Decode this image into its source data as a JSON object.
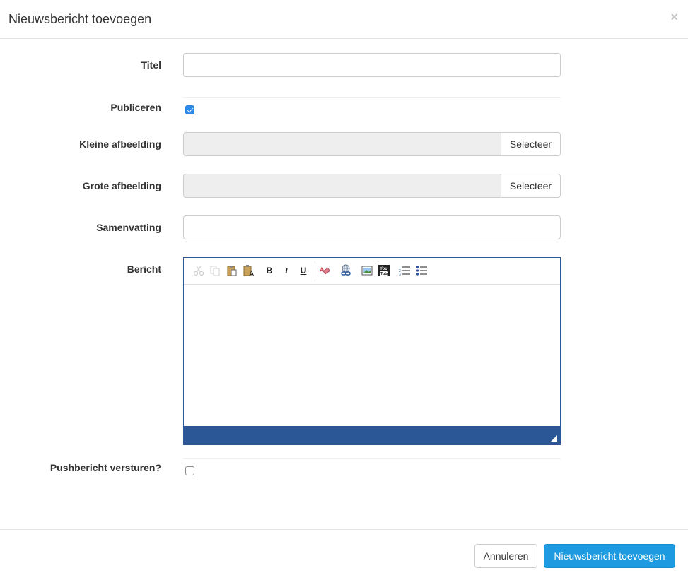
{
  "modal": {
    "title": "Nieuwsbericht toevoegen",
    "close_symbol": "×"
  },
  "form": {
    "title_label": "Titel",
    "title_value": "",
    "publish_label": "Publiceren",
    "publish_checked": true,
    "small_image_label": "Kleine afbeelding",
    "small_image_button": "Selecteer",
    "large_image_label": "Grote afbeelding",
    "large_image_button": "Selecteer",
    "summary_label": "Samenvatting",
    "summary_value": "",
    "message_label": "Bericht",
    "push_label": "Pushbericht versturen?",
    "push_checked": false
  },
  "editor": {
    "toolbar": [
      {
        "icon": "cut-icon",
        "enabled": false
      },
      {
        "icon": "copy-icon",
        "enabled": false
      },
      {
        "icon": "paste-icon",
        "enabled": true
      },
      {
        "icon": "paste-text-icon",
        "enabled": true
      },
      {
        "icon": "bold-icon",
        "enabled": true,
        "text": "B"
      },
      {
        "icon": "italic-icon",
        "enabled": true,
        "text": "I"
      },
      {
        "icon": "underline-icon",
        "enabled": true,
        "text": "U"
      },
      {
        "icon": "remove-format-icon",
        "enabled": true
      },
      {
        "icon": "link-icon",
        "enabled": true
      },
      {
        "icon": "image-icon",
        "enabled": true
      },
      {
        "icon": "youtube-icon",
        "enabled": true
      },
      {
        "icon": "numbered-list-icon",
        "enabled": true
      },
      {
        "icon": "bulleted-list-icon",
        "enabled": true
      }
    ],
    "accent_color": "#2b5797"
  },
  "footer": {
    "cancel_label": "Annuleren",
    "submit_label": "Nieuwsbericht toevoegen"
  },
  "colors": {
    "primary": "#1e9ae0",
    "checkbox_checked": "#2d8ceb"
  }
}
